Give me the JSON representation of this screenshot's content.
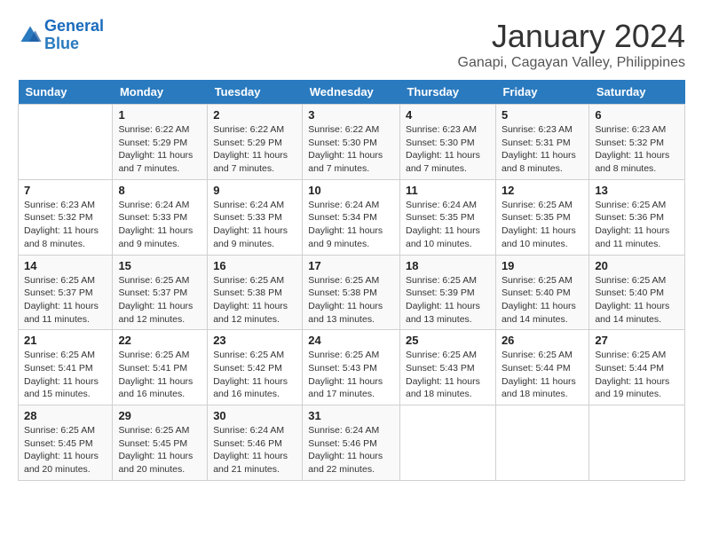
{
  "header": {
    "logo_line1": "General",
    "logo_line2": "Blue",
    "month": "January 2024",
    "location": "Ganapi, Cagayan Valley, Philippines"
  },
  "weekdays": [
    "Sunday",
    "Monday",
    "Tuesday",
    "Wednesday",
    "Thursday",
    "Friday",
    "Saturday"
  ],
  "weeks": [
    [
      {
        "day": "",
        "sunrise": "",
        "sunset": "",
        "daylight": ""
      },
      {
        "day": "1",
        "sunrise": "Sunrise: 6:22 AM",
        "sunset": "Sunset: 5:29 PM",
        "daylight": "Daylight: 11 hours and 7 minutes."
      },
      {
        "day": "2",
        "sunrise": "Sunrise: 6:22 AM",
        "sunset": "Sunset: 5:29 PM",
        "daylight": "Daylight: 11 hours and 7 minutes."
      },
      {
        "day": "3",
        "sunrise": "Sunrise: 6:22 AM",
        "sunset": "Sunset: 5:30 PM",
        "daylight": "Daylight: 11 hours and 7 minutes."
      },
      {
        "day": "4",
        "sunrise": "Sunrise: 6:23 AM",
        "sunset": "Sunset: 5:30 PM",
        "daylight": "Daylight: 11 hours and 7 minutes."
      },
      {
        "day": "5",
        "sunrise": "Sunrise: 6:23 AM",
        "sunset": "Sunset: 5:31 PM",
        "daylight": "Daylight: 11 hours and 8 minutes."
      },
      {
        "day": "6",
        "sunrise": "Sunrise: 6:23 AM",
        "sunset": "Sunset: 5:32 PM",
        "daylight": "Daylight: 11 hours and 8 minutes."
      }
    ],
    [
      {
        "day": "7",
        "sunrise": "Sunrise: 6:23 AM",
        "sunset": "Sunset: 5:32 PM",
        "daylight": "Daylight: 11 hours and 8 minutes."
      },
      {
        "day": "8",
        "sunrise": "Sunrise: 6:24 AM",
        "sunset": "Sunset: 5:33 PM",
        "daylight": "Daylight: 11 hours and 9 minutes."
      },
      {
        "day": "9",
        "sunrise": "Sunrise: 6:24 AM",
        "sunset": "Sunset: 5:33 PM",
        "daylight": "Daylight: 11 hours and 9 minutes."
      },
      {
        "day": "10",
        "sunrise": "Sunrise: 6:24 AM",
        "sunset": "Sunset: 5:34 PM",
        "daylight": "Daylight: 11 hours and 9 minutes."
      },
      {
        "day": "11",
        "sunrise": "Sunrise: 6:24 AM",
        "sunset": "Sunset: 5:35 PM",
        "daylight": "Daylight: 11 hours and 10 minutes."
      },
      {
        "day": "12",
        "sunrise": "Sunrise: 6:25 AM",
        "sunset": "Sunset: 5:35 PM",
        "daylight": "Daylight: 11 hours and 10 minutes."
      },
      {
        "day": "13",
        "sunrise": "Sunrise: 6:25 AM",
        "sunset": "Sunset: 5:36 PM",
        "daylight": "Daylight: 11 hours and 11 minutes."
      }
    ],
    [
      {
        "day": "14",
        "sunrise": "Sunrise: 6:25 AM",
        "sunset": "Sunset: 5:37 PM",
        "daylight": "Daylight: 11 hours and 11 minutes."
      },
      {
        "day": "15",
        "sunrise": "Sunrise: 6:25 AM",
        "sunset": "Sunset: 5:37 PM",
        "daylight": "Daylight: 11 hours and 12 minutes."
      },
      {
        "day": "16",
        "sunrise": "Sunrise: 6:25 AM",
        "sunset": "Sunset: 5:38 PM",
        "daylight": "Daylight: 11 hours and 12 minutes."
      },
      {
        "day": "17",
        "sunrise": "Sunrise: 6:25 AM",
        "sunset": "Sunset: 5:38 PM",
        "daylight": "Daylight: 11 hours and 13 minutes."
      },
      {
        "day": "18",
        "sunrise": "Sunrise: 6:25 AM",
        "sunset": "Sunset: 5:39 PM",
        "daylight": "Daylight: 11 hours and 13 minutes."
      },
      {
        "day": "19",
        "sunrise": "Sunrise: 6:25 AM",
        "sunset": "Sunset: 5:40 PM",
        "daylight": "Daylight: 11 hours and 14 minutes."
      },
      {
        "day": "20",
        "sunrise": "Sunrise: 6:25 AM",
        "sunset": "Sunset: 5:40 PM",
        "daylight": "Daylight: 11 hours and 14 minutes."
      }
    ],
    [
      {
        "day": "21",
        "sunrise": "Sunrise: 6:25 AM",
        "sunset": "Sunset: 5:41 PM",
        "daylight": "Daylight: 11 hours and 15 minutes."
      },
      {
        "day": "22",
        "sunrise": "Sunrise: 6:25 AM",
        "sunset": "Sunset: 5:41 PM",
        "daylight": "Daylight: 11 hours and 16 minutes."
      },
      {
        "day": "23",
        "sunrise": "Sunrise: 6:25 AM",
        "sunset": "Sunset: 5:42 PM",
        "daylight": "Daylight: 11 hours and 16 minutes."
      },
      {
        "day": "24",
        "sunrise": "Sunrise: 6:25 AM",
        "sunset": "Sunset: 5:43 PM",
        "daylight": "Daylight: 11 hours and 17 minutes."
      },
      {
        "day": "25",
        "sunrise": "Sunrise: 6:25 AM",
        "sunset": "Sunset: 5:43 PM",
        "daylight": "Daylight: 11 hours and 18 minutes."
      },
      {
        "day": "26",
        "sunrise": "Sunrise: 6:25 AM",
        "sunset": "Sunset: 5:44 PM",
        "daylight": "Daylight: 11 hours and 18 minutes."
      },
      {
        "day": "27",
        "sunrise": "Sunrise: 6:25 AM",
        "sunset": "Sunset: 5:44 PM",
        "daylight": "Daylight: 11 hours and 19 minutes."
      }
    ],
    [
      {
        "day": "28",
        "sunrise": "Sunrise: 6:25 AM",
        "sunset": "Sunset: 5:45 PM",
        "daylight": "Daylight: 11 hours and 20 minutes."
      },
      {
        "day": "29",
        "sunrise": "Sunrise: 6:25 AM",
        "sunset": "Sunset: 5:45 PM",
        "daylight": "Daylight: 11 hours and 20 minutes."
      },
      {
        "day": "30",
        "sunrise": "Sunrise: 6:24 AM",
        "sunset": "Sunset: 5:46 PM",
        "daylight": "Daylight: 11 hours and 21 minutes."
      },
      {
        "day": "31",
        "sunrise": "Sunrise: 6:24 AM",
        "sunset": "Sunset: 5:46 PM",
        "daylight": "Daylight: 11 hours and 22 minutes."
      },
      {
        "day": "",
        "sunrise": "",
        "sunset": "",
        "daylight": ""
      },
      {
        "day": "",
        "sunrise": "",
        "sunset": "",
        "daylight": ""
      },
      {
        "day": "",
        "sunrise": "",
        "sunset": "",
        "daylight": ""
      }
    ]
  ]
}
